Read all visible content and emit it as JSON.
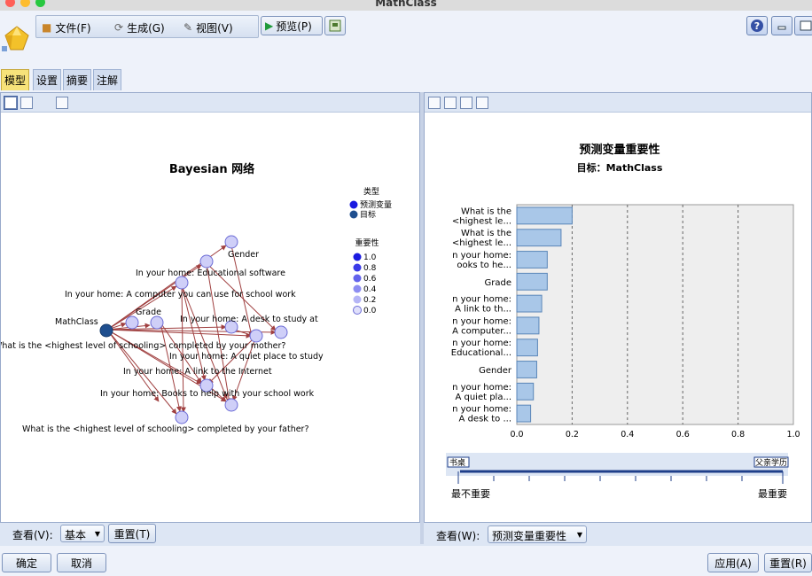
{
  "window": {
    "title": "MathClass"
  },
  "menu": {
    "file": "文件(F)",
    "generate": "生成(G)",
    "view": "视图(V)",
    "preview": "预览(P)"
  },
  "tabs": [
    {
      "label": "模型",
      "active": true
    },
    {
      "label": "设置",
      "active": false
    },
    {
      "label": "摘要",
      "active": false
    },
    {
      "label": "注解",
      "active": false
    }
  ],
  "network": {
    "title": "Bayesian 网络",
    "legend_type_heading": "类型",
    "legend_types": [
      "预测变量",
      "目标"
    ],
    "legend_importance_heading": "重要性",
    "legend_importance": [
      "1.0",
      "0.8",
      "0.6",
      "0.4",
      "0.2",
      "0.0"
    ],
    "target_label": "MathClass",
    "node_labels": {
      "gender": "Gender",
      "software": "In your home: Educational software",
      "computer": "In your home: A computer you can use for school work",
      "grade": "Grade",
      "desk": "In your home: A desk to study at",
      "mother": "What is the <highest level of schooling> completed by your mother?",
      "quiet": "In your home: A quiet place to study",
      "internet": "In your home: A link to the Internet",
      "books": "In your home: Books to help with your school work",
      "father": "What is the <highest level of schooling> completed by your father?"
    },
    "colors": {
      "edge": "#a04040",
      "target_node": "#1f4f8f",
      "predictor_node": "#cfcff8",
      "predictor_stroke": "#6b6bd6"
    }
  },
  "chart_data": {
    "type": "bar",
    "orientation": "horizontal",
    "title": "预测变量重要性",
    "subtitle": "目标：MathClass",
    "categories": [
      [
        "What is the",
        "<highest le..."
      ],
      [
        "What is the",
        "<highest le..."
      ],
      [
        "n your home:",
        "ooks to he..."
      ],
      [
        "Grade"
      ],
      [
        "n your home:",
        "A link to th..."
      ],
      [
        "n your home:",
        "A computer..."
      ],
      [
        "n your home:",
        "Educational..."
      ],
      [
        "Gender"
      ],
      [
        "n your home:",
        "A quiet pla..."
      ],
      [
        "n your home:",
        "A desk to ..."
      ]
    ],
    "values": [
      0.2,
      0.16,
      0.11,
      0.11,
      0.09,
      0.08,
      0.075,
      0.072,
      0.06,
      0.05
    ],
    "xlim": [
      0.0,
      1.0
    ],
    "xticks": [
      "0.0",
      "0.2",
      "0.4",
      "0.6",
      "0.8",
      "1.0"
    ],
    "grid": true,
    "bar_color": "#a9c7e8",
    "bar_stroke": "#5a86b8"
  },
  "importance_scale": {
    "left_tag": "书桌",
    "right_tag": "父亲学历",
    "left_label": "最不重要",
    "right_label": "最重要"
  },
  "left_bottom": {
    "view_label": "查看(V):",
    "view_value": "基本",
    "reset": "重置(T)"
  },
  "right_bottom": {
    "view_label": "查看(W):",
    "view_value": "预测变量重要性"
  },
  "footer": {
    "ok": "确定",
    "cancel": "取消",
    "apply": "应用(A)",
    "reset": "重置(R)"
  }
}
